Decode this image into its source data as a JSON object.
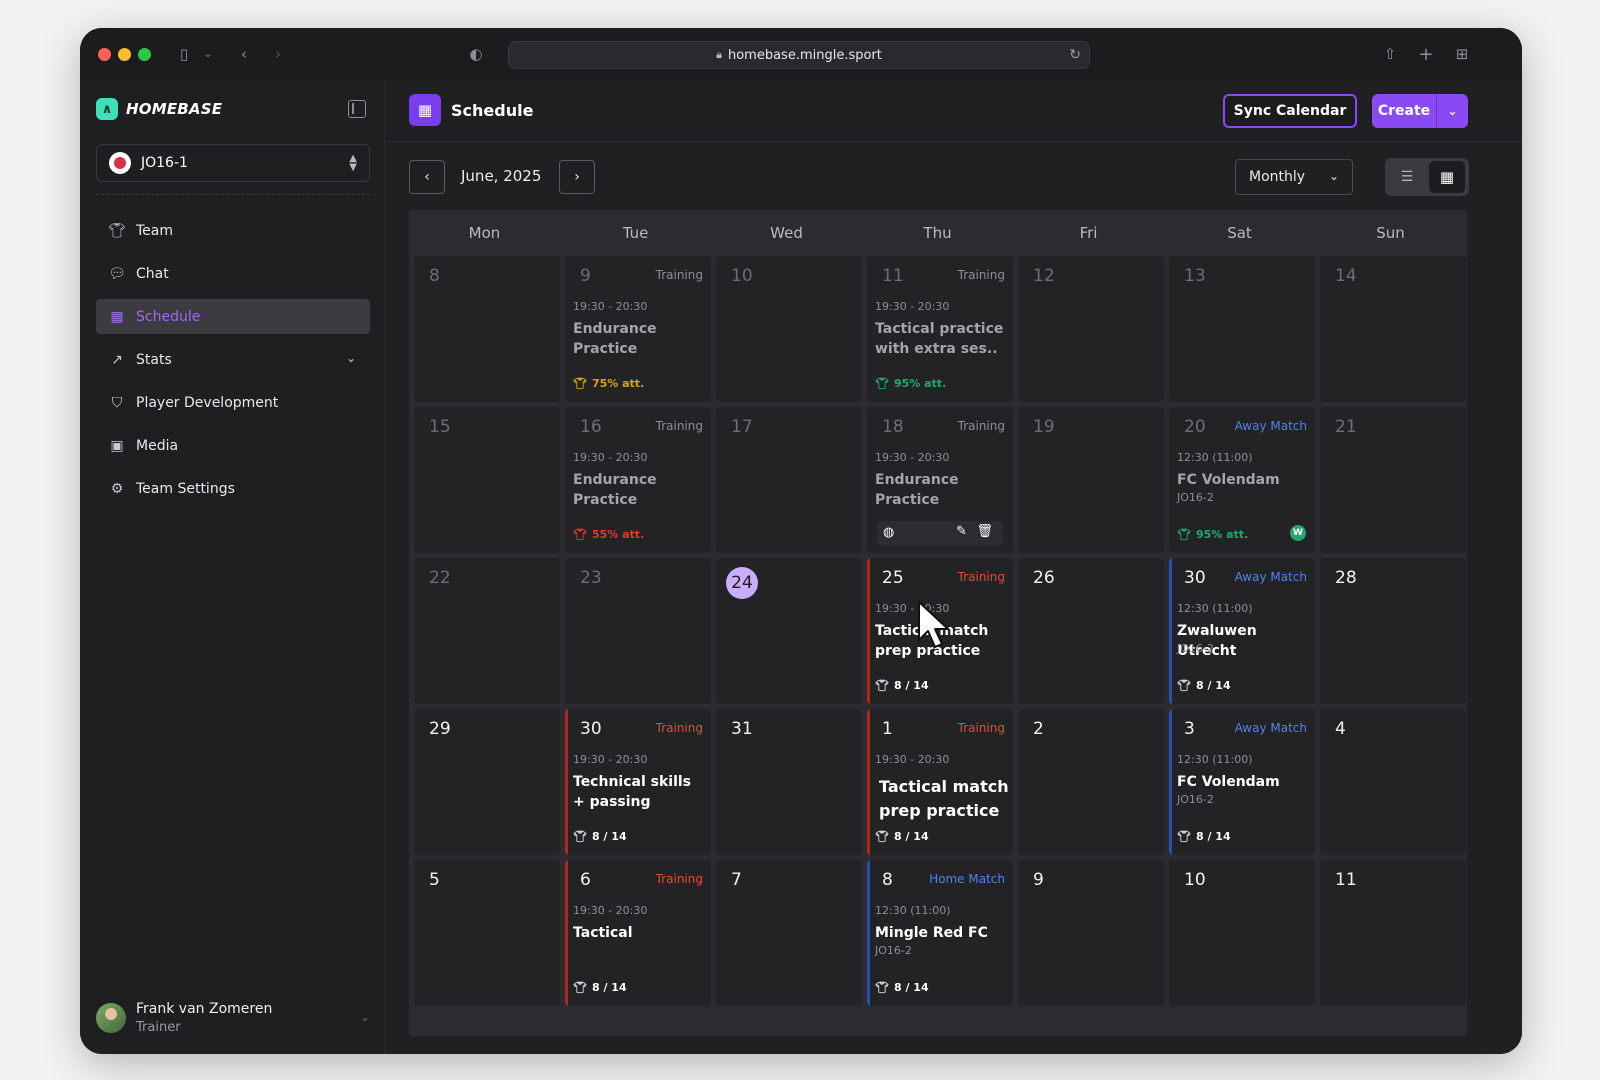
{
  "browser": {
    "url": "homebase.mingle.sport"
  },
  "brand": {
    "name": "HOMEBASE",
    "logo_glyph": "∧"
  },
  "team_select": {
    "value": "JO16-1"
  },
  "nav": {
    "items": [
      {
        "label": "Team",
        "icon": "shirt-icon"
      },
      {
        "label": "Chat",
        "icon": "chat-icon"
      },
      {
        "label": "Schedule",
        "icon": "calendar-icon"
      },
      {
        "label": "Stats",
        "icon": "chart-icon"
      },
      {
        "label": "Player Development",
        "icon": "shield-icon"
      },
      {
        "label": "Media",
        "icon": "image-icon"
      },
      {
        "label": "Team Settings",
        "icon": "gear-icon"
      }
    ]
  },
  "user": {
    "name": "Frank van Zomeren",
    "role": "Trainer"
  },
  "header": {
    "title": "Schedule",
    "sync_label": "Sync Calendar",
    "create_label": "Create"
  },
  "toolbar": {
    "month": "June, 2025",
    "view": "Monthly"
  },
  "calendar": {
    "weekdays": [
      "Mon",
      "Tue",
      "Wed",
      "Thu",
      "Fri",
      "Sat",
      "Sun"
    ],
    "days": [
      {
        "num": "8"
      },
      {
        "num": "9",
        "type": "Training",
        "time": "19:30 - 20:30",
        "title": "Endurance Practice",
        "att": "75% att."
      },
      {
        "num": "10"
      },
      {
        "num": "11",
        "type": "Training",
        "time": "19:30 - 20:30",
        "title": "Tactical practice with extra ses..",
        "att": "95% att."
      },
      {
        "num": "12"
      },
      {
        "num": "13"
      },
      {
        "num": "14"
      },
      {
        "num": "15"
      },
      {
        "num": "16",
        "type": "Training",
        "time": "19:30 - 20:30",
        "title": "Endurance Practice",
        "att": "55% att."
      },
      {
        "num": "17"
      },
      {
        "num": "18",
        "type": "Training",
        "time": "19:30 - 20:30",
        "title": "Endurance Practice"
      },
      {
        "num": "19"
      },
      {
        "num": "20",
        "type": "Away Match",
        "time": "12:30 (11:00)",
        "title": "FC Volendam",
        "sub": "JO16-2",
        "att": "95% att.",
        "badge": "W"
      },
      {
        "num": "21"
      },
      {
        "num": "22"
      },
      {
        "num": "23"
      },
      {
        "num": "24"
      },
      {
        "num": "25",
        "type": "Training",
        "time": "19:30 - 20:30",
        "title": "Tactical match prep practice",
        "att": "8 / 14"
      },
      {
        "num": "26"
      },
      {
        "num": "30",
        "type": "Away Match",
        "time": "12:30 (11:00)",
        "title": "Zwaluwen Utrecht",
        "sub": "JO16-2",
        "att": "8 / 14"
      },
      {
        "num": "28"
      },
      {
        "num": "29"
      },
      {
        "num": "30",
        "type": "Training",
        "time": "19:30 - 20:30",
        "title": "Technical skills + passing",
        "att": "8 / 14"
      },
      {
        "num": "31"
      },
      {
        "num": "1",
        "type": "Training",
        "time": "19:30 - 20:30",
        "title": "Tactical match prep practice",
        "att": "8 / 14"
      },
      {
        "num": "2"
      },
      {
        "num": "3",
        "type": "Away Match",
        "time": "12:30 (11:00)",
        "title": "FC Volendam",
        "sub": "JO16-2",
        "att": "8 / 14"
      },
      {
        "num": "4"
      },
      {
        "num": "5"
      },
      {
        "num": "6",
        "type": "Training",
        "time": "19:30 - 20:30",
        "title": "Tactical",
        "att": "8 / 14"
      },
      {
        "num": "7"
      },
      {
        "num": "8",
        "type": "Home Match",
        "time": "12:30 (11:00)",
        "title": "Mingle Red FC",
        "sub": "JO16-2",
        "att": "8 / 14"
      },
      {
        "num": "9"
      },
      {
        "num": "10"
      },
      {
        "num": "11"
      }
    ]
  },
  "colors": {
    "accent": "#8a4af3",
    "training": "#e24b3a",
    "match": "#4e83ee",
    "today": "#c9adff",
    "att_good": "#22a86c",
    "att_mid": "#d9a319",
    "att_low": "#e23a2e"
  }
}
